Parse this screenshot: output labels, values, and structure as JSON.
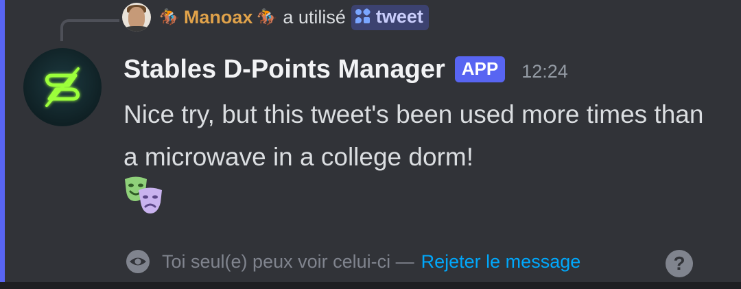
{
  "reply": {
    "user": "Manoax",
    "user_emoji": "🏇",
    "verb": "a utilisé",
    "command": "tweet"
  },
  "message": {
    "author": "Stables D-Points Manager",
    "badge": "APP",
    "timestamp": "12:24",
    "text": "Nice try, but this tweet's been used more times than a microwave in a college dorm!",
    "reaction_emoji": "🎭"
  },
  "ephemeral": {
    "notice": "Toi seul(e) peux voir celui-ci —",
    "dismiss_label": "Rejeter le message",
    "help_label": "?"
  },
  "colors": {
    "background": "#313338",
    "accent": "#5865f2",
    "link": "#00a8fc",
    "reply_user": "#e0a24a",
    "logo_green": "#9cff3a"
  },
  "icons": {
    "avatar": "neon-s-logo",
    "command": "app-command-icon",
    "ephemeral": "eye-icon",
    "help": "question-icon"
  }
}
